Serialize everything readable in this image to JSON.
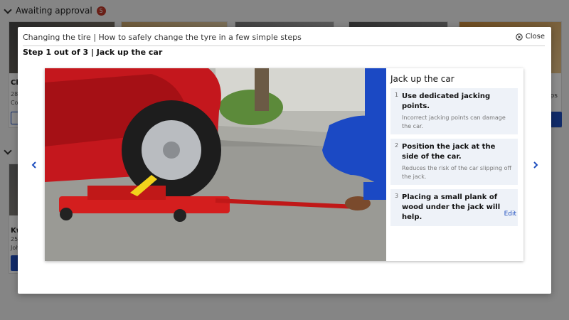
{
  "background": {
    "section_title": "Awaiting approval",
    "badge_count": "5",
    "cards": [
      {
        "title": "Ch",
        "meta_line1": "28-",
        "meta_line2": "Co"
      },
      {
        "title": "Kw",
        "meta_line1": "25-",
        "meta_line2": "Joh"
      }
    ],
    "right_fragment": "eps"
  },
  "modal": {
    "title": "Changing the tire | How to safely change the tyre in a few simple steps",
    "close_label": "Close",
    "step_label": "Step 1 out of 3 | Jack up the car",
    "prev_icon": "chevron-left-icon",
    "next_icon": "chevron-right-icon"
  },
  "panel": {
    "title": "Jack up the car",
    "steps": [
      {
        "num": "1",
        "head": "Use dedicated jacking points.",
        "sub": "Incorrect jacking points can damage the car."
      },
      {
        "num": "2",
        "head": "Position the jack at the side of the car.",
        "sub": "Reduces the risk of the car slipping off the jack."
      },
      {
        "num": "3",
        "head": "Placing a small plank of wood under the jack will help.",
        "sub": ""
      }
    ],
    "edit_label": "Edit"
  },
  "colors": {
    "accent": "#1f4fbf",
    "badge": "#c0392b",
    "step_bg": "#eef2f8"
  }
}
